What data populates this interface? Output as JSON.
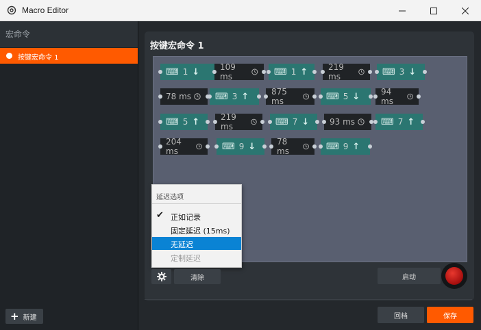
{
  "window": {
    "title": "Macro Editor"
  },
  "sidebar": {
    "header": "宏命令",
    "items": [
      {
        "label": "按键宏命令 1"
      }
    ],
    "new_label": "新建"
  },
  "editor": {
    "title": "按键宏命令 1",
    "steps": [
      {
        "type": "key",
        "value": "1",
        "direction": "down"
      },
      {
        "type": "delay",
        "value": "109 ms"
      },
      {
        "type": "key",
        "value": "1",
        "direction": "up"
      },
      {
        "type": "delay",
        "value": "219 ms"
      },
      {
        "type": "key",
        "value": "3",
        "direction": "down"
      },
      {
        "type": "delay",
        "value": "78 ms"
      },
      {
        "type": "key",
        "value": "3",
        "direction": "up"
      },
      {
        "type": "delay",
        "value": "875 ms"
      },
      {
        "type": "key",
        "value": "5",
        "direction": "down"
      },
      {
        "type": "delay",
        "value": "94 ms"
      },
      {
        "type": "key",
        "value": "5",
        "direction": "up"
      },
      {
        "type": "delay",
        "value": "219 ms"
      },
      {
        "type": "key",
        "value": "7",
        "direction": "down"
      },
      {
        "type": "delay",
        "value": "93 ms"
      },
      {
        "type": "key",
        "value": "7",
        "direction": "up"
      },
      {
        "type": "delay",
        "value": "204 ms"
      },
      {
        "type": "key",
        "value": "9",
        "direction": "down"
      },
      {
        "type": "delay",
        "value": "78 ms"
      },
      {
        "type": "key",
        "value": "9",
        "direction": "up"
      }
    ],
    "clear_label": "清除",
    "start_label": "启动"
  },
  "delay_menu": {
    "header": "延迟选项",
    "items": [
      {
        "label": "正如记录",
        "checked": true,
        "selected": false,
        "disabled": false
      },
      {
        "label": "固定延迟 (15ms)",
        "checked": false,
        "selected": false,
        "disabled": false
      },
      {
        "label": "无延迟",
        "checked": false,
        "selected": true,
        "disabled": false
      },
      {
        "label": "定制延迟",
        "checked": false,
        "selected": false,
        "disabled": true
      }
    ]
  },
  "footer": {
    "revert_label": "回档",
    "save_label": "保存"
  },
  "colors": {
    "accent": "#ff5a00",
    "key_step": "#2b7671",
    "delay_step": "#202326",
    "selection": "#0a83d4"
  }
}
